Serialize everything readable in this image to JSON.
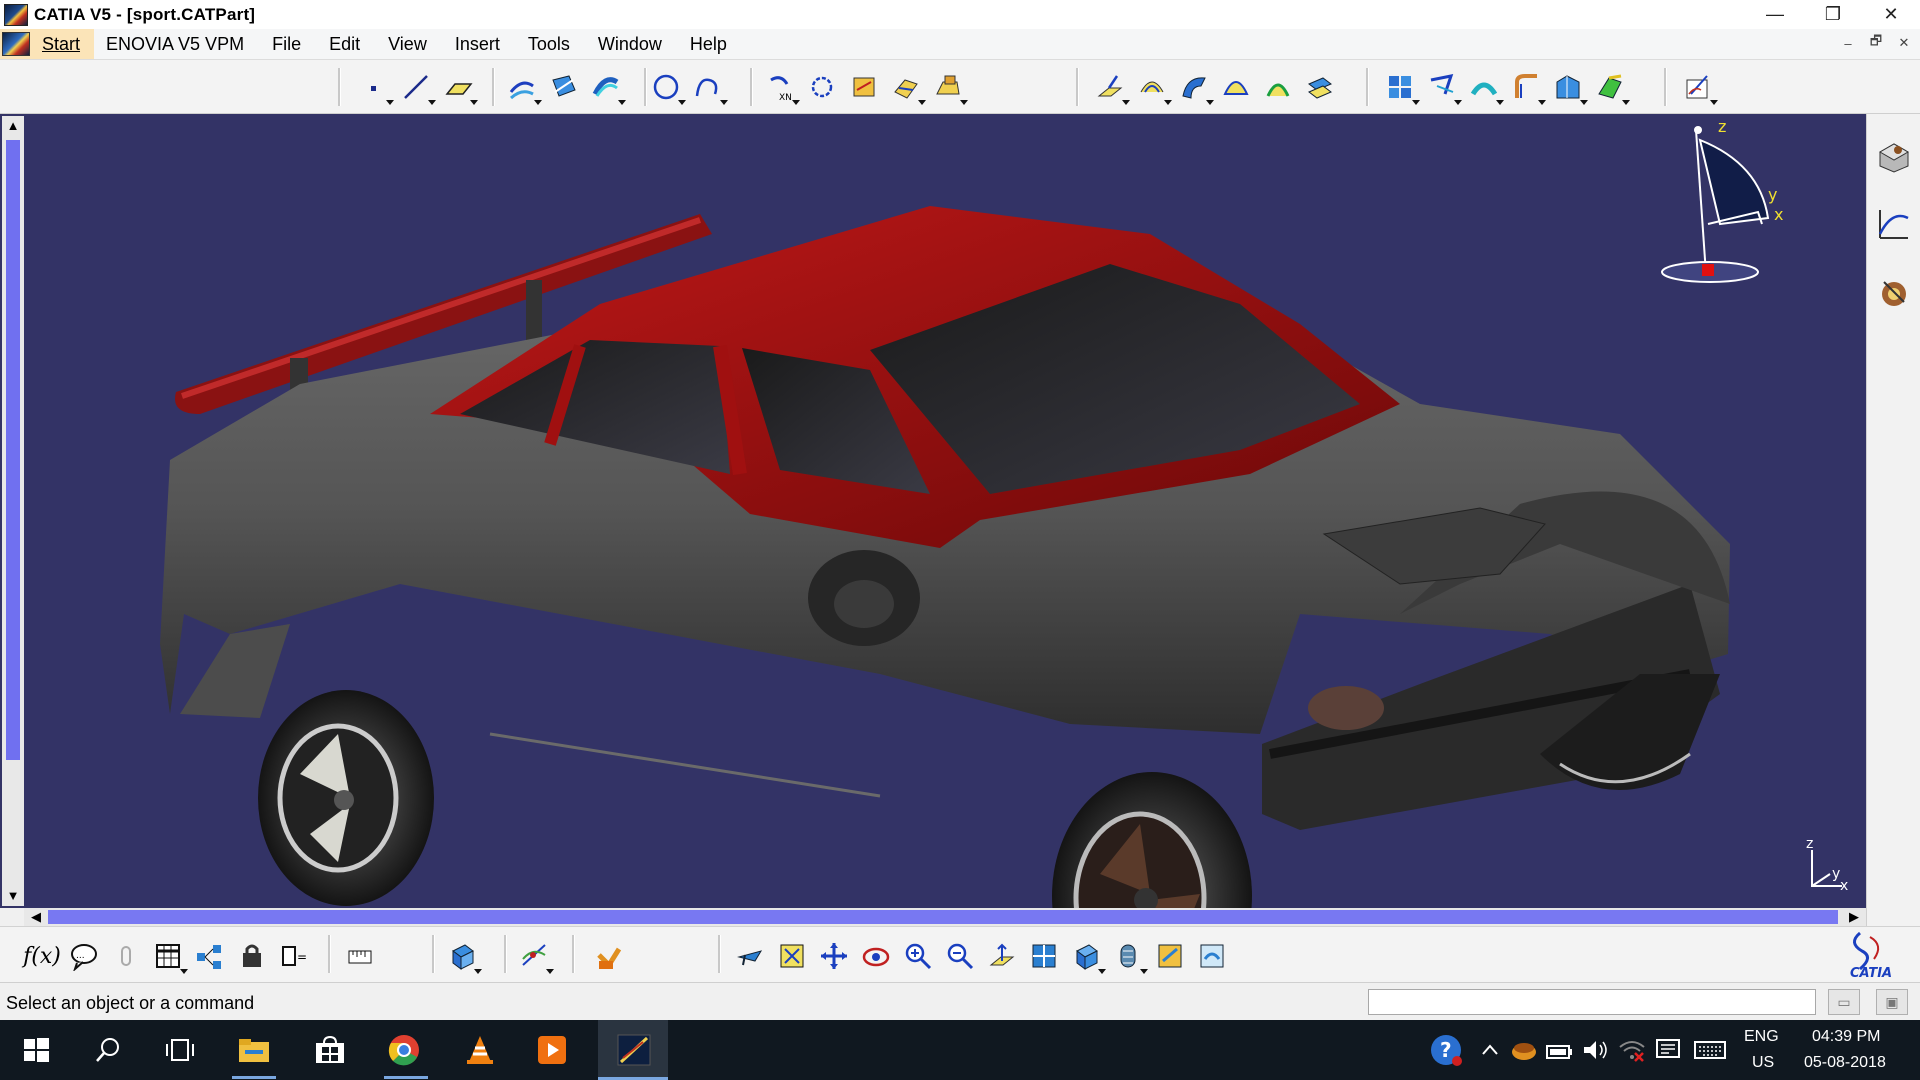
{
  "window": {
    "title": "CATIA V5 - [sport.CATPart]",
    "controls": {
      "minimize": "—",
      "restore": "❐",
      "close": "✕"
    }
  },
  "menubar": {
    "start": "Start",
    "items": [
      {
        "label": "ENOVIA V5 VPM"
      },
      {
        "label": "File"
      },
      {
        "label": "Edit"
      },
      {
        "label": "View"
      },
      {
        "label": "Insert"
      },
      {
        "label": "Tools"
      },
      {
        "label": "Window"
      },
      {
        "label": "Help"
      }
    ],
    "doc_controls": {
      "minimize": "–",
      "restore": "🗗",
      "close": "✕"
    }
  },
  "toolbar_top": {
    "icons": [
      "point-icon",
      "line-icon",
      "plane-icon",
      "projection-icon",
      "intersection-icon",
      "parallel-curve-icon",
      "circle-icon",
      "spline-icon",
      "translate-icon",
      "symmetry-icon",
      "split-icon",
      "trim-icon",
      "join-icon",
      "extrude-surface-icon",
      "revolve-surface-icon",
      "sweep-surface-icon",
      "fill-surface-icon",
      "loft-surface-icon",
      "blend-surface-icon",
      "multi-section-icon",
      "boundary-icon",
      "extract-icon",
      "fillet-icon",
      "edge-fillet-icon",
      "variable-fillet-icon",
      "chamfer-icon",
      "sketcher-icon"
    ]
  },
  "viewport": {
    "background": "#333366",
    "compass_labels": {
      "z": "z",
      "y": "y",
      "x": "x"
    },
    "axis_labels": {
      "z": "z",
      "y": "y",
      "x": "x"
    }
  },
  "right_panel": {
    "icons": [
      "part-design-icon",
      "sketch-analysis-icon",
      "photo-studio-icon"
    ]
  },
  "toolbar_bottom": {
    "formula": "f(x)",
    "icons": [
      "formula-icon",
      "comment-icon",
      "knowledge-icon",
      "table-icon",
      "tree-icon",
      "lock-icon",
      "parameters-icon",
      "measure-icon",
      "apply-material-icon",
      "analysis-icon",
      "render-icon",
      "fly-mode-icon",
      "fit-all-icon",
      "pan-icon",
      "rotate-icon",
      "zoom-in-icon",
      "zoom-out-icon",
      "normal-view-icon",
      "multi-view-icon",
      "iso-view-icon",
      "shading-icon",
      "hide-show-icon",
      "swap-visible-icon"
    ],
    "logo_text": "CATIA"
  },
  "statusbar": {
    "message": "Select an object or a command"
  },
  "taskbar": {
    "apps": [
      "windows-start-icon",
      "search-icon",
      "task-view-icon",
      "file-explorer-icon",
      "store-icon",
      "chrome-icon",
      "vlc-icon",
      "media-player-icon",
      "catia-taskbar-icon"
    ],
    "tray": {
      "lang_top": "ENG",
      "lang_bottom": "US",
      "time": "04:39 PM",
      "date": "05-08-2018"
    }
  }
}
